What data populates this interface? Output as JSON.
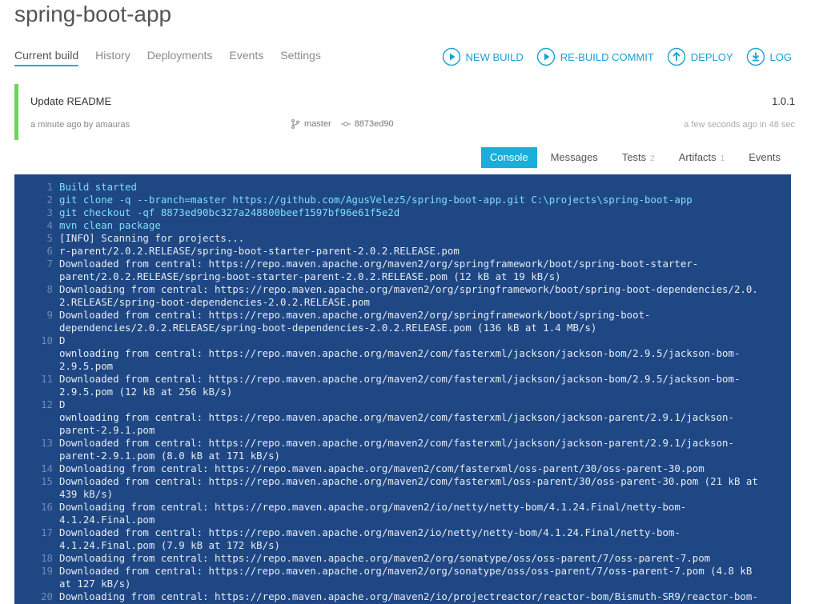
{
  "app": {
    "title": "spring-boot-app"
  },
  "nav": {
    "tabs": [
      {
        "label": "Current build",
        "active": true
      },
      {
        "label": "History"
      },
      {
        "label": "Deployments"
      },
      {
        "label": "Events"
      },
      {
        "label": "Settings"
      }
    ]
  },
  "actions": {
    "new_build": "NEW BUILD",
    "rebuild_commit": "RE-BUILD COMMIT",
    "deploy": "DEPLOY",
    "log": "LOG"
  },
  "build": {
    "message": "Update README",
    "version": "1.0.1",
    "meta": "a minute ago by amauras",
    "branch": "master",
    "commit": "8873ed90",
    "time": "a few seconds ago in 48 sec",
    "status_color": "#6dd35a"
  },
  "subtabs": {
    "console": "Console",
    "messages": "Messages",
    "tests": "Tests",
    "tests_count": "2",
    "artifacts": "Artifacts",
    "artifacts_count": "1",
    "events": "Events"
  },
  "console": {
    "lines": [
      {
        "n": "1",
        "cmd": true,
        "text": "Build started"
      },
      {
        "n": "2",
        "cmd": true,
        "text": "git clone -q --branch=master https://github.com/AgusVelez5/spring-boot-app.git C:\\projects\\spring-boot-app"
      },
      {
        "n": "3",
        "cmd": true,
        "text": "git checkout -qf 8873ed90bc327a248800beef1597bf96e61f5e2d"
      },
      {
        "n": "4",
        "cmd": true,
        "text": "mvn clean package"
      },
      {
        "n": "5",
        "text": "[INFO] Scanning for projects..."
      },
      {
        "n": "6",
        "text": "r-parent/2.0.2.RELEASE/spring-boot-starter-parent-2.0.2.RELEASE.pom"
      },
      {
        "n": "7",
        "text": "Downloaded from central: https://repo.maven.apache.org/maven2/org/springframework/boot/spring-boot-starter-\nparent/2.0.2.RELEASE/spring-boot-starter-parent-2.0.2.RELEASE.pom (12 kB at 19 kB/s)"
      },
      {
        "n": "8",
        "text": "Downloading from central: https://repo.maven.apache.org/maven2/org/springframework/boot/spring-boot-dependencies/2.0.\n2.RELEASE/spring-boot-dependencies-2.0.2.RELEASE.pom"
      },
      {
        "n": "9",
        "text": "Downloaded from central: https://repo.maven.apache.org/maven2/org/springframework/boot/spring-boot-\ndependencies/2.0.2.RELEASE/spring-boot-dependencies-2.0.2.RELEASE.pom (136 kB at 1.4 MB/s)"
      },
      {
        "n": "10",
        "text": "D\nownloading from central: https://repo.maven.apache.org/maven2/com/fasterxml/jackson/jackson-bom/2.9.5/jackson-bom-\n2.9.5.pom"
      },
      {
        "n": "11",
        "text": "Downloaded from central: https://repo.maven.apache.org/maven2/com/fasterxml/jackson/jackson-bom/2.9.5/jackson-bom-\n2.9.5.pom (12 kB at 256 kB/s)"
      },
      {
        "n": "12",
        "text": "D\nownloading from central: https://repo.maven.apache.org/maven2/com/fasterxml/jackson/jackson-parent/2.9.1/jackson-\nparent-2.9.1.pom"
      },
      {
        "n": "13",
        "text": "Downloaded from central: https://repo.maven.apache.org/maven2/com/fasterxml/jackson/jackson-parent/2.9.1/jackson-\nparent-2.9.1.pom (8.0 kB at 171 kB/s)"
      },
      {
        "n": "14",
        "text": "Downloading from central: https://repo.maven.apache.org/maven2/com/fasterxml/oss-parent/30/oss-parent-30.pom"
      },
      {
        "n": "15",
        "text": "Downloaded from central: https://repo.maven.apache.org/maven2/com/fasterxml/oss-parent/30/oss-parent-30.pom (21 kB at\n439 kB/s)"
      },
      {
        "n": "16",
        "text": "Downloading from central: https://repo.maven.apache.org/maven2/io/netty/netty-bom/4.1.24.Final/netty-bom-\n4.1.24.Final.pom"
      },
      {
        "n": "17",
        "text": "Downloaded from central: https://repo.maven.apache.org/maven2/io/netty/netty-bom/4.1.24.Final/netty-bom-\n4.1.24.Final.pom (7.9 kB at 172 kB/s)"
      },
      {
        "n": "18",
        "text": "Downloading from central: https://repo.maven.apache.org/maven2/org/sonatype/oss/oss-parent/7/oss-parent-7.pom"
      },
      {
        "n": "19",
        "text": "Downloaded from central: https://repo.maven.apache.org/maven2/org/sonatype/oss/oss-parent/7/oss-parent-7.pom (4.8 kB\nat 127 kB/s)"
      },
      {
        "n": "20",
        "text": "Downloading from central: https://repo.maven.apache.org/maven2/io/projectreactor/reactor-bom/Bismuth-SR9/reactor-bom-"
      }
    ]
  }
}
